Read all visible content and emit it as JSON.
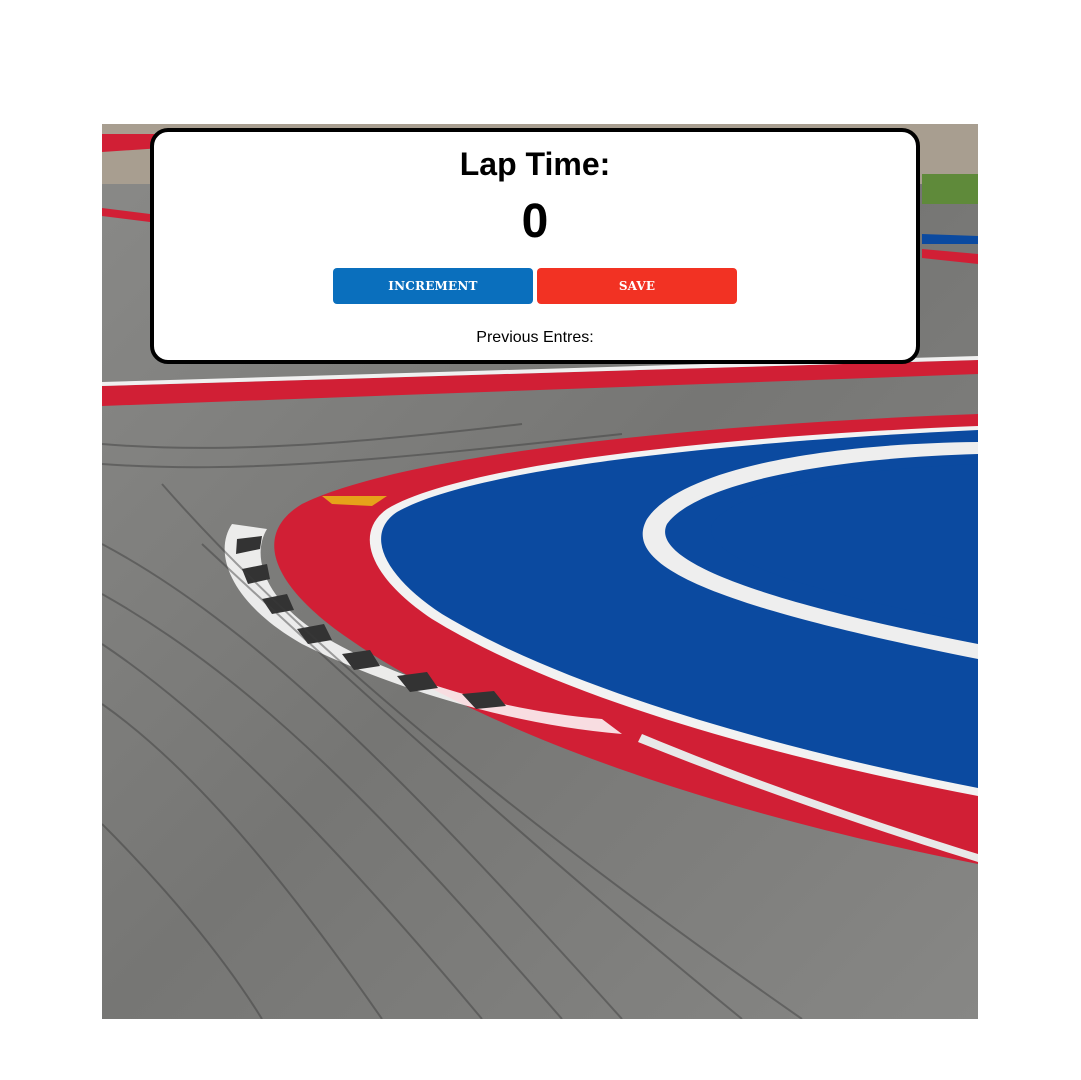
{
  "card": {
    "title": "Lap Time:",
    "counter_value": "0",
    "increment_label": "INCREMENT",
    "save_label": "SAVE",
    "previous_entries_label": "Previous Entres:"
  },
  "colors": {
    "increment_button": "#0a6fbd",
    "save_button": "#f23223",
    "track_red": "#d11f35",
    "track_blue": "#0b4aa0",
    "asphalt": "#7c7c7c"
  },
  "background_image": {
    "icon": "race-track-curve-photo"
  }
}
